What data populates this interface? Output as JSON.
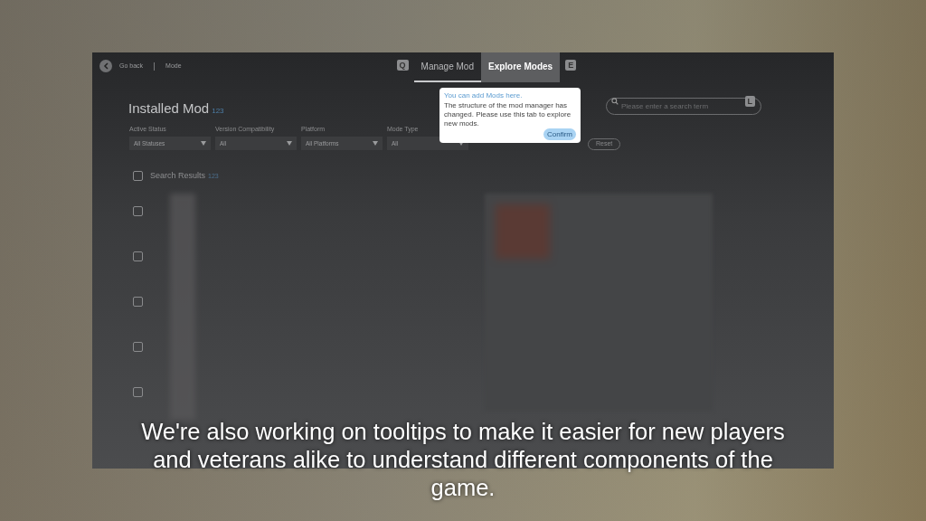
{
  "header": {
    "back_label": "Go back",
    "breadcrumb": "Mode",
    "tabs": [
      {
        "label": "Manage Mod",
        "key": "Q",
        "selected": true,
        "highlighted": false
      },
      {
        "label": "Explore Modes",
        "key": "E",
        "selected": false,
        "highlighted": true
      }
    ]
  },
  "tooltip": {
    "title": "You can add Mods here.",
    "body": "The structure of the mod manager has changed. Please use this tab to explore new mods.",
    "button": "Confirm"
  },
  "installed": {
    "title": "Installed Mod",
    "count": "123"
  },
  "search": {
    "placeholder": "Please enter a search term",
    "key": "L"
  },
  "filters": [
    {
      "label": "Active Status",
      "value": "All Statuses"
    },
    {
      "label": "Version Compatibility",
      "value": "All"
    },
    {
      "label": "Platform",
      "value": "All Platforms"
    },
    {
      "label": "Mode Type",
      "value": "All"
    }
  ],
  "reset_button": "Reset",
  "results": {
    "title": "Search Results",
    "count": "123",
    "checked": false,
    "rows": [
      {
        "checked": false
      },
      {
        "checked": false
      },
      {
        "checked": false
      },
      {
        "checked": false
      },
      {
        "checked": false
      }
    ]
  },
  "caption": "We're also working on tooltips to make it easier for new players and veterans alike to understand different components of the game."
}
